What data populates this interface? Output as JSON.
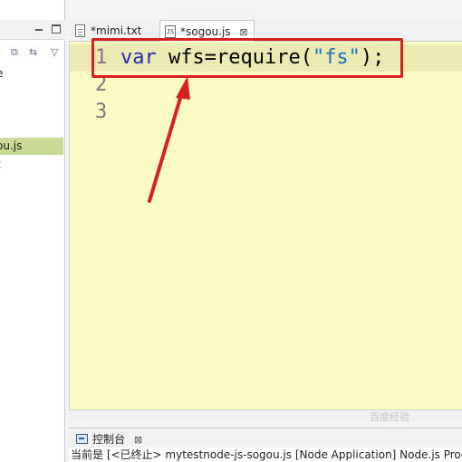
{
  "explorer": {
    "toolbar_icons": [
      "collapse-all-icon",
      "link-with-editor-icon",
      "view-menu-icon"
    ],
    "items": [
      {
        "label": "e",
        "selected": false
      },
      {
        "label": "ou.js",
        "selected": true
      },
      {
        "label": "t",
        "selected": false
      }
    ]
  },
  "editor": {
    "tabs": [
      {
        "label": "*mimi.txt",
        "icon": "text-file-icon",
        "active": false
      },
      {
        "label": "*sogou.js",
        "icon": "js-file-icon",
        "active": true
      }
    ],
    "line_numbers": [
      "1",
      "2",
      "3"
    ],
    "code": {
      "keyword": "var",
      "middle": " wfs=require(",
      "string": "\"fs\"",
      "end": ");"
    }
  },
  "console": {
    "tab_label": "控制台",
    "status": "当前是 [<已终止> mytestnode-js-sogou.js [Node Application] Node.js Proc"
  },
  "watermark": "百度经验",
  "colors": {
    "editor_bg": "#fbfbc4",
    "current_line": "#eaeab2",
    "highlight_border": "#d92020",
    "arrow": "#d92020",
    "keyword": "#2a2ab5",
    "string": "#1d6fbe",
    "selected_item": "#c8da95"
  }
}
